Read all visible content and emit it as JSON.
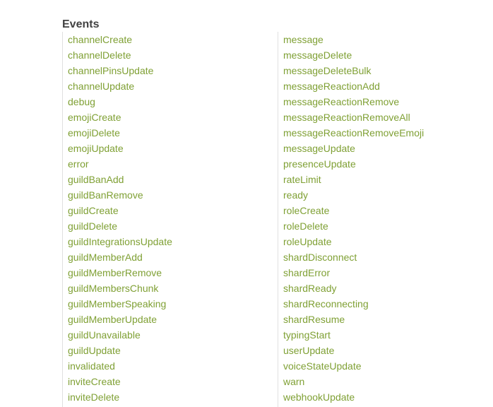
{
  "section": {
    "title": "Events"
  },
  "colors": {
    "link": "#7fa034",
    "title": "#424242",
    "divider": "#e0e0e0"
  },
  "events": {
    "left": [
      "channelCreate",
      "channelDelete",
      "channelPinsUpdate",
      "channelUpdate",
      "debug",
      "emojiCreate",
      "emojiDelete",
      "emojiUpdate",
      "error",
      "guildBanAdd",
      "guildBanRemove",
      "guildCreate",
      "guildDelete",
      "guildIntegrationsUpdate",
      "guildMemberAdd",
      "guildMemberRemove",
      "guildMembersChunk",
      "guildMemberSpeaking",
      "guildMemberUpdate",
      "guildUnavailable",
      "guildUpdate",
      "invalidated",
      "inviteCreate",
      "inviteDelete"
    ],
    "right": [
      "message",
      "messageDelete",
      "messageDeleteBulk",
      "messageReactionAdd",
      "messageReactionRemove",
      "messageReactionRemoveAll",
      "messageReactionRemoveEmoji",
      "messageUpdate",
      "presenceUpdate",
      "rateLimit",
      "ready",
      "roleCreate",
      "roleDelete",
      "roleUpdate",
      "shardDisconnect",
      "shardError",
      "shardReady",
      "shardReconnecting",
      "shardResume",
      "typingStart",
      "userUpdate",
      "voiceStateUpdate",
      "warn",
      "webhookUpdate"
    ]
  }
}
